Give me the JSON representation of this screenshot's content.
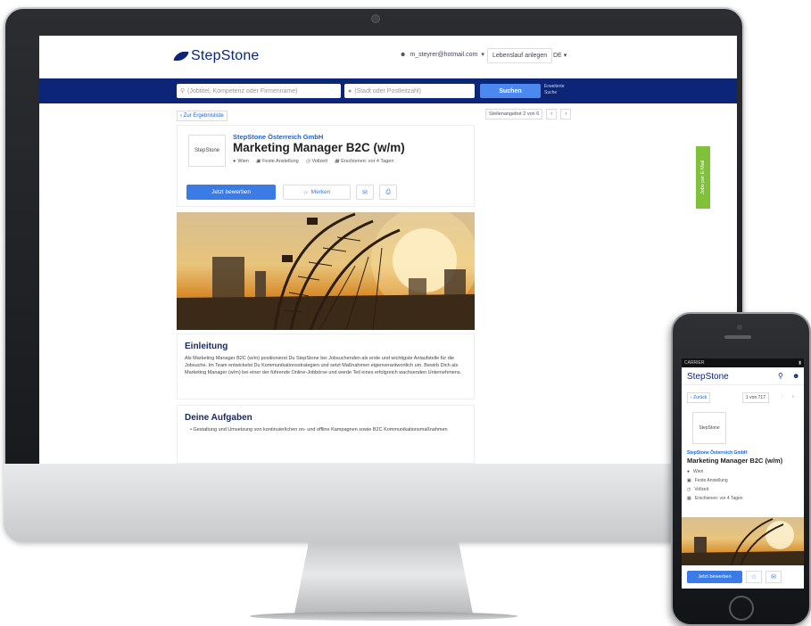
{
  "header": {
    "logo": "StepStone",
    "user_email": "m_steyrer@hotmail.com",
    "cv_button": "Lebenslauf anlegen",
    "language": "DE"
  },
  "search": {
    "what_placeholder": "(Jobtitel, Kompetenz oder Firmenname)",
    "where_placeholder": "(Stadt oder Postleitzahl)",
    "submit_label": "Suchen",
    "advanced_label_1": "Erweiterte",
    "advanced_label_2": "Suche"
  },
  "nav": {
    "back_label": "Zur Ergebnisliste",
    "pager_text": "Stellenangebot 2 von 6"
  },
  "job": {
    "company": "StepStone Österreich GmbH",
    "company_logo_text": "StepStone",
    "title": "Marketing Manager B2C (w/m)",
    "location": "Wien",
    "contract": "Feste Anstellung",
    "worktime": "Vollzeit",
    "published": "Erschienen: vor 4 Tagen",
    "apply_label": "Jetzt bewerben",
    "save_label": "Merken"
  },
  "sections": {
    "intro_title": "Einleitung",
    "intro_text": "Als Marketing Manager B2C (w/m) positionierst Du StepStone bei Jobsuchenden als erste und wichtigste Anlaufstelle für die Jobsuche. Im Team entwickelst Du Kommunikationsstrategien und setzt Maßnahmen eigenverantwortlich um. Bewirb Dich als Marketing Manager (w/m) bei einer der führende Online-Jobbörse und werde Teil eines erfolgreich wachsenden Unternehmens.",
    "tasks_title": "Deine Aufgaben",
    "tasks_item_1": "Gestaltung und Umsetzung von kontinuierlichen on- und offline Kampagnen sowie B2C Kommunikationsmaßnahmen"
  },
  "side_tab": {
    "label": "Jobs per E-Mail"
  },
  "phone": {
    "carrier": "CARRIER",
    "logo": "StepStone",
    "back_label": "Zurück",
    "count": "1 von 717",
    "company_logo_text": "StepStone",
    "company": "StepStone Österreich GmbH",
    "title": "Marketing Manager B2C (w/m)",
    "location": "Wien",
    "contract": "Feste Anstellung",
    "worktime": "Vollzeit",
    "published": "Erschienen: vor 4 Tagen",
    "apply_label": "Jetzt bewerben"
  },
  "colors": {
    "brand_navy": "#0c2577",
    "accent_blue": "#3b7be6",
    "mail_tab_green": "#7fc23a"
  }
}
